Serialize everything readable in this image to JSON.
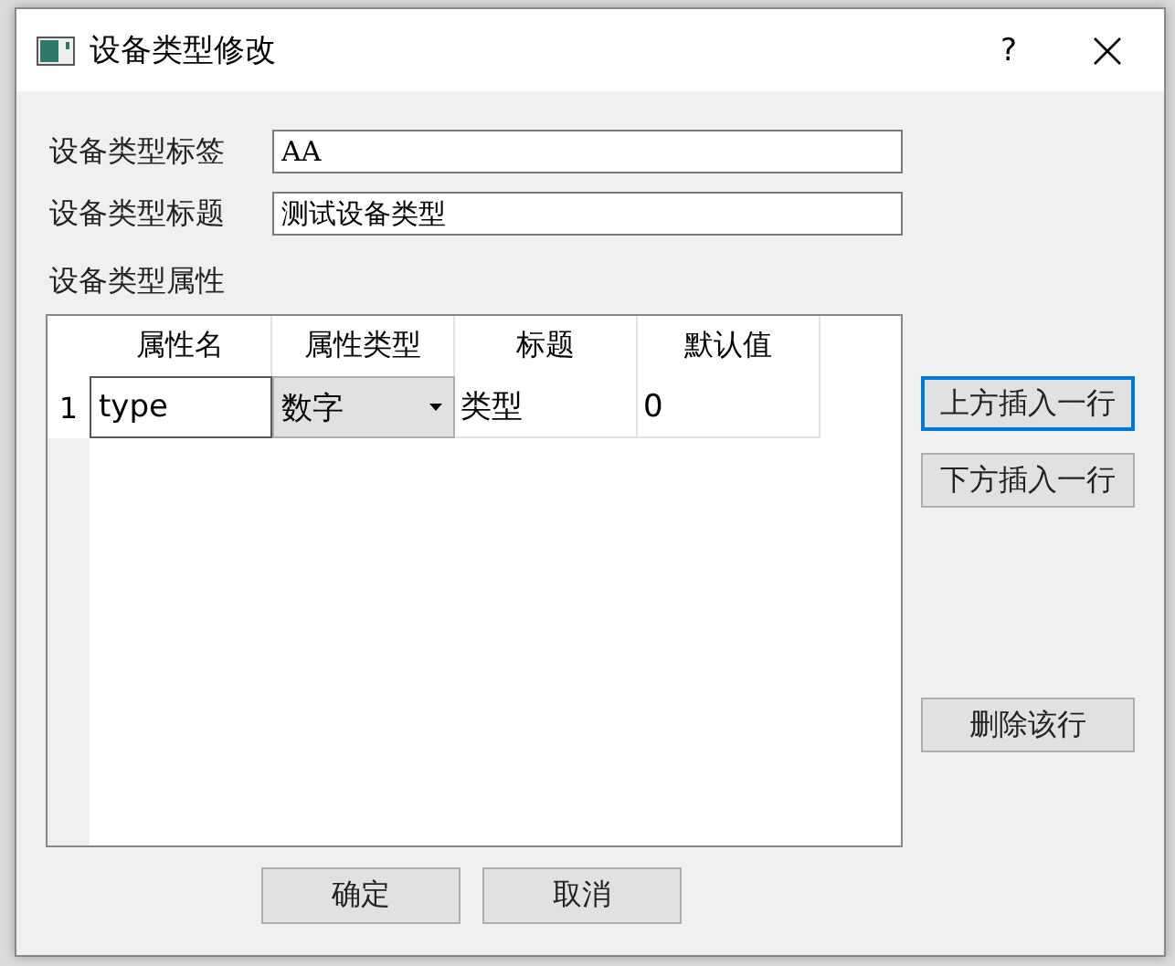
{
  "window": {
    "title": "设备类型修改",
    "help": "?"
  },
  "fields": [
    {
      "label": "设备类型标签",
      "value": "AA"
    },
    {
      "label": "设备类型标题",
      "value": "测试设备类型"
    }
  ],
  "section_label": "设备类型属性",
  "table": {
    "columns": [
      "属性名",
      "属性类型",
      "标题",
      "默认值"
    ],
    "rows": [
      {
        "header": "1",
        "cells": [
          {
            "kind": "edit",
            "text": "type"
          },
          {
            "kind": "combo",
            "text": "数字"
          },
          {
            "kind": "text",
            "text": "类型"
          },
          {
            "kind": "text",
            "text": "0"
          }
        ]
      }
    ]
  },
  "side_buttons": [
    {
      "label": "上方插入一行",
      "focused": true,
      "kind": "insert"
    },
    {
      "label": "下方插入一行",
      "focused": false,
      "kind": "insert"
    },
    {
      "label": "删除该行",
      "focused": false,
      "kind": "delete"
    }
  ],
  "buttons": [
    {
      "label": "确定",
      "focused": false
    },
    {
      "label": "取消",
      "focused": false
    }
  ]
}
